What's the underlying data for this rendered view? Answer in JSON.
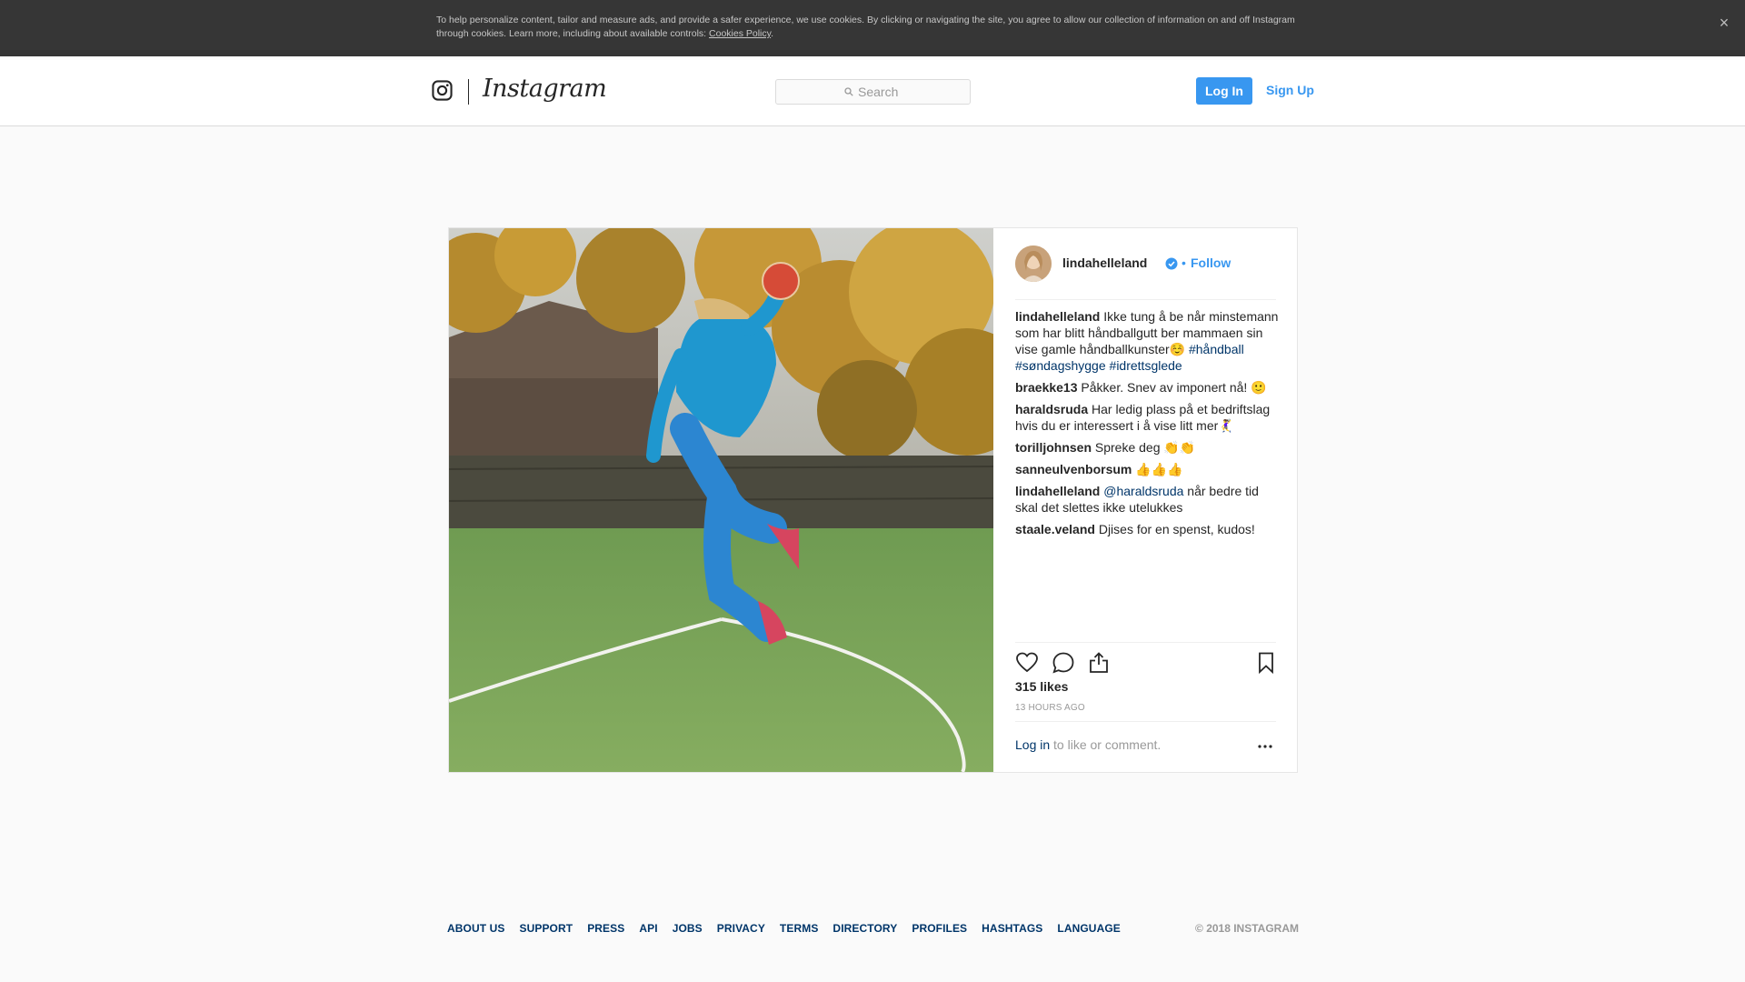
{
  "cookie_banner": {
    "text": "To help personalize content, tailor and measure ads, and provide a safer experience, we use cookies. By clicking or navigating the site, you agree to allow our collection of information on and off Instagram through cookies. Learn more, including about available controls: ",
    "link": "Cookies Policy",
    "close_icon": "close-icon"
  },
  "header": {
    "logo_icon": "instagram-camera-icon",
    "wordmark": "Instagram",
    "search_placeholder": "Search",
    "login_label": "Log In",
    "signup_label": "Sign Up"
  },
  "post": {
    "username": "lindahelleland",
    "verified_icon": "verified-badge-icon",
    "dot": "•",
    "follow_label": "Follow",
    "comments": [
      {
        "user": "lindahelleland",
        "text": " Ikke tung å be når minstemann som har blitt håndballgutt ber mammaen sin vise gamle håndballkunster☺️ ",
        "tags": [
          "#håndball",
          "#søndagshygge",
          "#idrettsglede"
        ]
      },
      {
        "user": "braekke13",
        "text": " Påkker. Snev av imponert nå! 🙂"
      },
      {
        "user": "haraldsruda",
        "text": " Har ledig plass på et bedriftslag hvis du er interessert i å vise litt mer🤾‍♀️"
      },
      {
        "user": "torilljohnsen",
        "text": " Spreke deg 👏👏"
      },
      {
        "user": "sanneulvenborsum",
        "text": " 👍👍👍"
      },
      {
        "user": "lindahelleland",
        "mention": "@haraldsruda",
        "text": " når bedre tid skal det slettes ikke utelukkes"
      },
      {
        "user": "staale.veland",
        "text": " Djises for en spenst, kudos!"
      }
    ],
    "likes": "315 likes",
    "time": "13 HOURS AGO",
    "add_comment_login": "Log in",
    "add_comment_rest": " to like or comment.",
    "icons": [
      "heart-icon",
      "comment-icon",
      "share-icon",
      "bookmark-icon",
      "more-options-icon"
    ]
  },
  "footer": {
    "links": [
      "ABOUT US",
      "SUPPORT",
      "PRESS",
      "API",
      "JOBS",
      "PRIVACY",
      "TERMS",
      "DIRECTORY",
      "PROFILES",
      "HASHTAGS",
      "LANGUAGE"
    ],
    "copyright": "© 2018 INSTAGRAM"
  },
  "colors": {
    "accent": "#3897f0",
    "link_dark": "#003569",
    "banner_bg": "#363636"
  }
}
